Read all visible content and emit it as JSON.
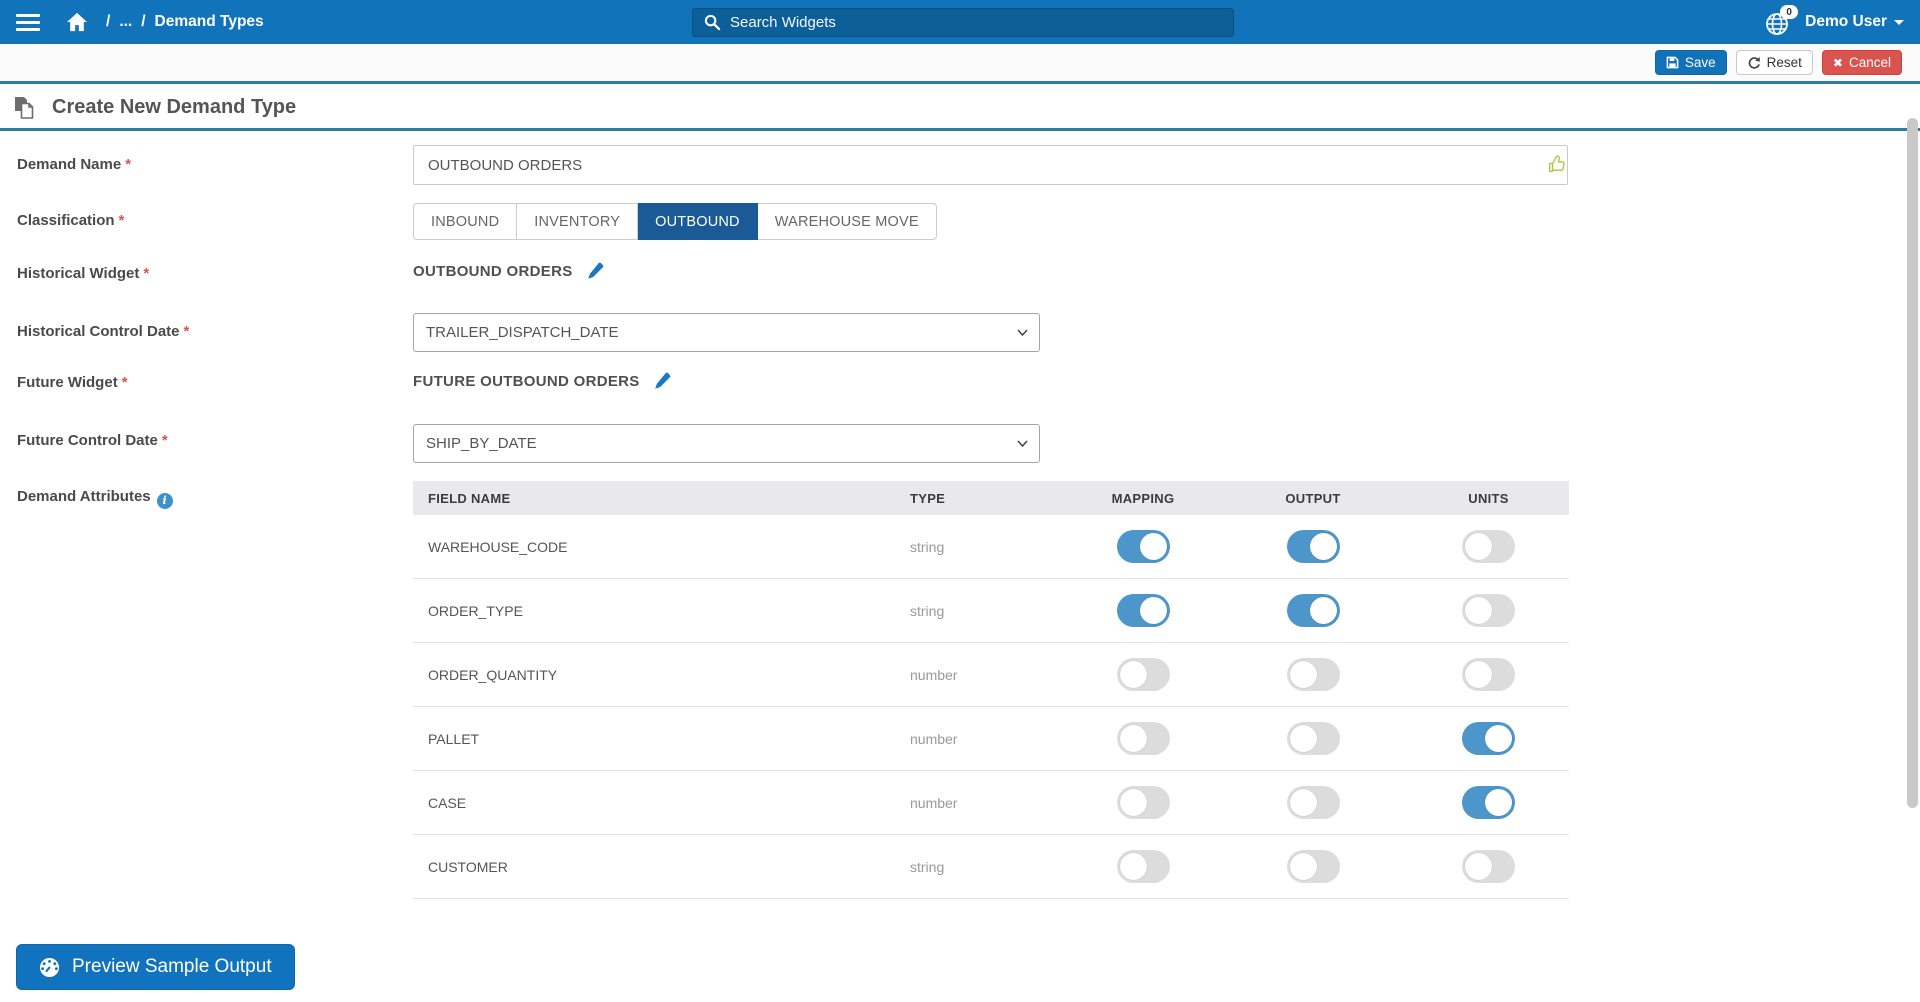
{
  "navbar": {
    "breadcrumb": {
      "separator": "/",
      "ellipsis": "...",
      "current": "Demand Types"
    },
    "search": {
      "placeholder": "Search Widgets"
    },
    "user": {
      "name": "Demo User",
      "badge_count": "0"
    }
  },
  "toolbar": {
    "save": "Save",
    "reset": "Reset",
    "cancel": "Cancel"
  },
  "page_header": {
    "title": "Create New Demand Type"
  },
  "form": {
    "demand_name": {
      "label": "Demand Name",
      "required": "*",
      "value": "OUTBOUND ORDERS"
    },
    "classification": {
      "label": "Classification",
      "required": "*",
      "options": [
        {
          "label": "INBOUND",
          "selected": "false"
        },
        {
          "label": "INVENTORY",
          "selected": "false"
        },
        {
          "label": "OUTBOUND",
          "selected": "true"
        },
        {
          "label": "WAREHOUSE MOVE",
          "selected": "false"
        }
      ]
    },
    "historical_widget": {
      "label": "Historical Widget",
      "required": "*",
      "value": "OUTBOUND ORDERS"
    },
    "historical_control_date": {
      "label": "Historical Control Date",
      "required": "*",
      "value": "TRAILER_DISPATCH_DATE"
    },
    "future_widget": {
      "label": "Future Widget",
      "required": "*",
      "value": "FUTURE OUTBOUND ORDERS"
    },
    "future_control_date": {
      "label": "Future Control Date",
      "required": "*",
      "value": "SHIP_BY_DATE"
    },
    "demand_attributes": {
      "label": "Demand Attributes"
    }
  },
  "attributes_table": {
    "headers": [
      "FIELD NAME",
      "TYPE",
      "MAPPING",
      "OUTPUT",
      "UNITS"
    ],
    "rows": [
      {
        "name": "WAREHOUSE_CODE",
        "type": "string",
        "mapping": "on",
        "output": "on",
        "units": "off"
      },
      {
        "name": "ORDER_TYPE",
        "type": "string",
        "mapping": "on",
        "output": "on",
        "units": "off"
      },
      {
        "name": "ORDER_QUANTITY",
        "type": "number",
        "mapping": "off",
        "output": "off",
        "units": "off"
      },
      {
        "name": "PALLET",
        "type": "number",
        "mapping": "off",
        "output": "off",
        "units": "on"
      },
      {
        "name": "CASE",
        "type": "number",
        "mapping": "off",
        "output": "off",
        "units": "on"
      },
      {
        "name": "CUSTOMER",
        "type": "string",
        "mapping": "off",
        "output": "off",
        "units": "off"
      }
    ]
  },
  "footer": {
    "preview_button": "Preview Sample Output"
  },
  "accent_colors": {
    "navbar_blue": "#1173b9",
    "search_field_blue": "#0d5f9a",
    "section_divider_teal": "#2b7ea1",
    "primary_button_blue": "#1272b8",
    "cancel_red": "#d9534f",
    "selected_classification_blue": "#1a5a96",
    "toggle_on_blue": "#4d96c9",
    "edit_pencil_blue": "#1b78c4",
    "thumb_up_green": "#a8cf45"
  }
}
